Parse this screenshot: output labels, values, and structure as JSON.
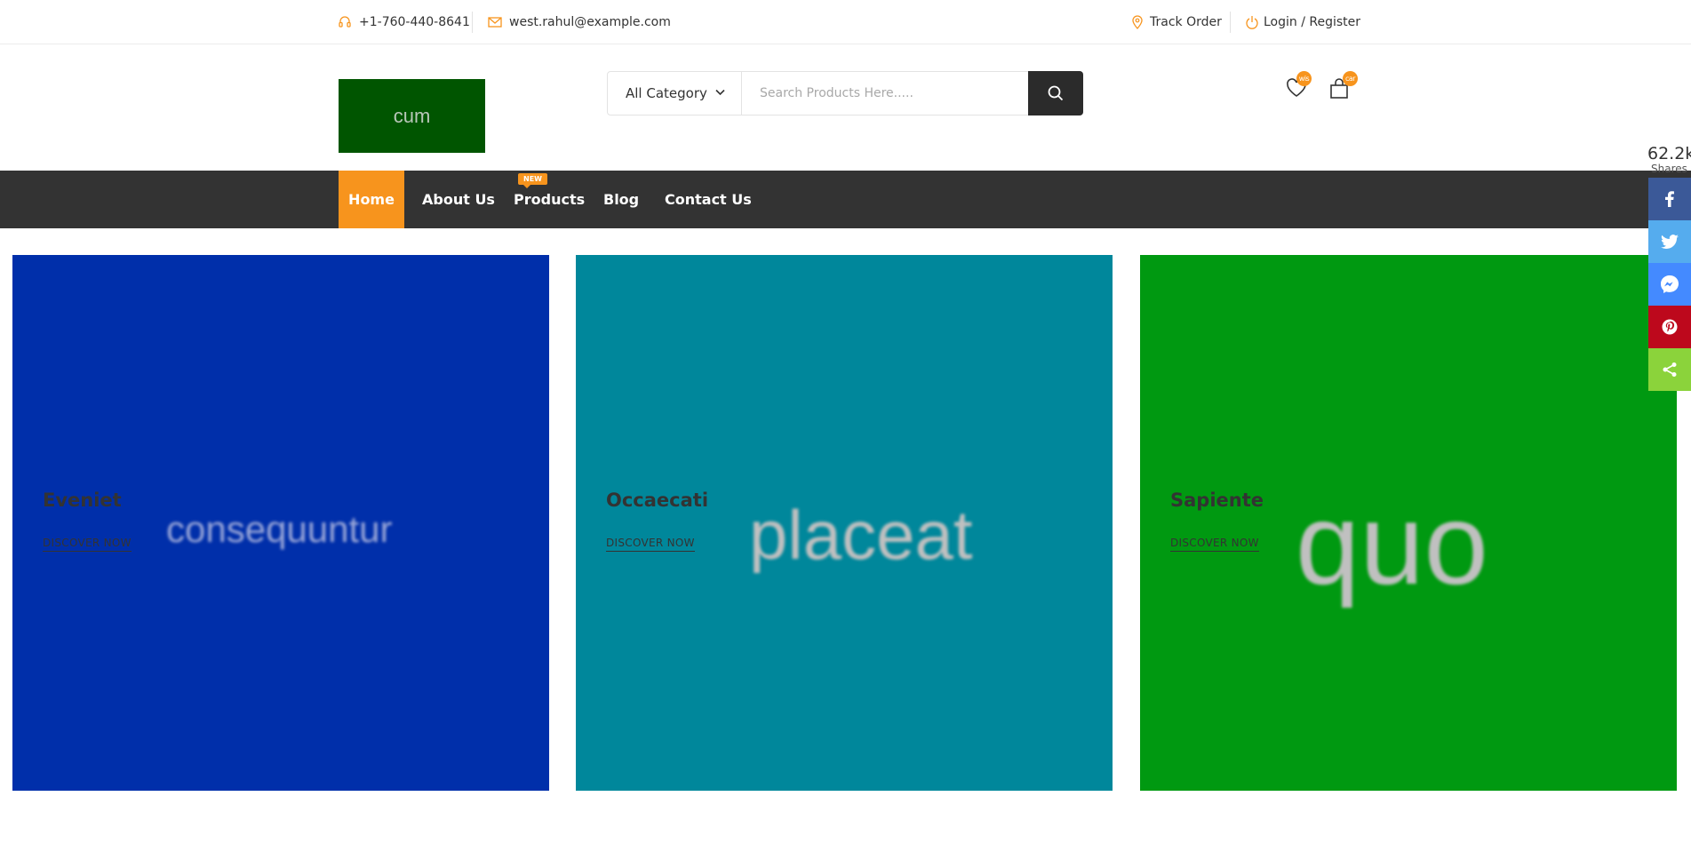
{
  "topbar": {
    "phone": "+1-760-440-8641",
    "email": "west.rahul@example.com",
    "track_order": "Track Order",
    "login_register": "Login / Register"
  },
  "header": {
    "logo_text": "cum",
    "category_label": "All Category",
    "search_placeholder": "Search Products Here.....",
    "wishlist_badge": "wis",
    "cart_badge": "car"
  },
  "nav": {
    "items": [
      {
        "label": "Home"
      },
      {
        "label": "About Us"
      },
      {
        "label": "Products",
        "tag": "NEW"
      },
      {
        "label": "Blog"
      },
      {
        "label": "Contact Us"
      }
    ]
  },
  "banners": [
    {
      "title": "Eveniet",
      "link": "DISCOVER NOW",
      "art_text": "consequuntur",
      "color": "#002faa"
    },
    {
      "title": "Occaecati",
      "link": "DISCOVER NOW",
      "art_text": "placeat",
      "color": "#00879b"
    },
    {
      "title": "Sapiente",
      "link": "DISCOVER NOW",
      "art_text": "quo",
      "color": "#009911"
    }
  ],
  "share": {
    "count": "62.2k",
    "label": "Shares",
    "buttons": [
      {
        "icon": "facebook-icon",
        "color": "#3b5998"
      },
      {
        "icon": "twitter-icon",
        "color": "#55acee"
      },
      {
        "icon": "messenger-icon",
        "color": "#448aff"
      },
      {
        "icon": "pinterest-icon",
        "color": "#bd081c"
      },
      {
        "icon": "share-icon",
        "color": "#8bd33b"
      }
    ]
  },
  "colors": {
    "accent": "#f7941d",
    "nav_bg": "#333333"
  }
}
